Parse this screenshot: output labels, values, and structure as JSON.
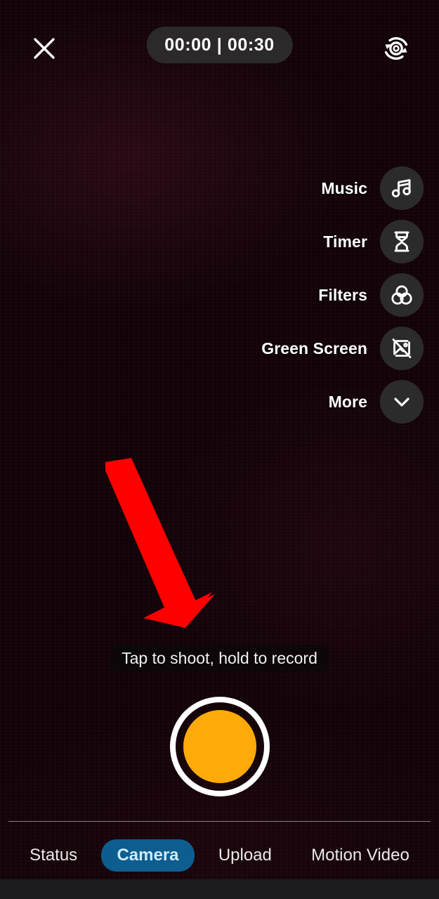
{
  "app": {
    "screen_name": "Camera capture",
    "background_color": "#120208"
  },
  "topbar": {
    "close_label": "Close",
    "close_icon": "close-x-icon",
    "timer": {
      "elapsed": "00:00",
      "separator": "|",
      "total": "00:30",
      "display": "00:00 | 00:30"
    },
    "flip_camera_label": "Flip camera",
    "flip_camera_icon": "camera-flip-icon"
  },
  "tool_rail": {
    "items": [
      {
        "label": "Music",
        "icon": "music-note-icon"
      },
      {
        "label": "Timer",
        "icon": "hourglass-icon"
      },
      {
        "label": "Filters",
        "icon": "filters-circles-icon"
      },
      {
        "label": "Green Screen",
        "icon": "image-slash-icon"
      },
      {
        "label": "More",
        "icon": "chevron-down-icon"
      }
    ]
  },
  "annotation": {
    "type": "arrow",
    "color": "#FF0000",
    "direction": "down-right",
    "points_to": "shutter-button"
  },
  "hint": {
    "text": "Tap to shoot, hold to record"
  },
  "shutter": {
    "label": "Shutter",
    "core_color": "#FFAA09",
    "ring_color": "#FFFFFF"
  },
  "tabbar": {
    "active": "Camera",
    "active_color": "#0d5d8f",
    "tabs": [
      {
        "label": "Status",
        "active": false
      },
      {
        "label": "Camera",
        "active": true
      },
      {
        "label": "Upload",
        "active": false
      },
      {
        "label": "Motion Video",
        "active": false
      }
    ]
  }
}
